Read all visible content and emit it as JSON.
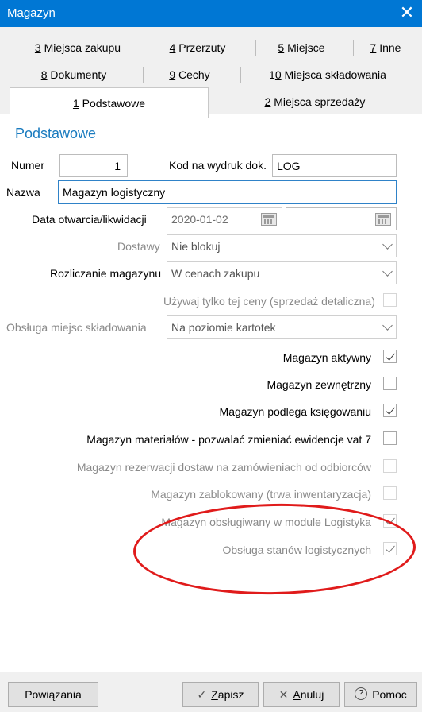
{
  "window": {
    "title": "Magazyn",
    "close_glyph": "✕"
  },
  "tabs": {
    "row1": [
      {
        "num": "3",
        "label": " Miejsca zakupu"
      },
      {
        "num": "4",
        "label": " Przerzuty"
      },
      {
        "num": "5",
        "label": " Miejsce"
      },
      {
        "num": "7",
        "label": " Inne"
      }
    ],
    "row2": [
      {
        "num": "8",
        "label": " Dokumenty"
      },
      {
        "num": "9",
        "label": " Cechy"
      },
      {
        "num_prefix": "1",
        "num": "0",
        "label": " Miejsca składowania"
      }
    ],
    "row3": [
      {
        "num": "1",
        "label": " Podstawowe",
        "active": true
      },
      {
        "num": "2",
        "label": " Miejsca sprzedaży"
      }
    ]
  },
  "section_title": "Podstawowe",
  "fields": {
    "numer": {
      "label": "Numer",
      "value": "1"
    },
    "kod": {
      "label": "Kod na wydruk dok.",
      "value": "LOG"
    },
    "nazwa": {
      "label": "Nazwa",
      "value": "Magazyn logistyczny"
    },
    "data": {
      "label": "Data otwarcia/likwidacji",
      "value": "2020-01-02",
      "value2": ""
    },
    "dostawy": {
      "label": "Dostawy",
      "value": "Nie blokuj"
    },
    "rozliczanie": {
      "label": "Rozliczanie magazynu",
      "value": "W cenach zakupu"
    },
    "uzywaj": {
      "label": "Używaj tylko tej ceny (sprzedaż detaliczna)",
      "checked": false
    },
    "obsluga_miejsc": {
      "label": "Obsługa miejsc składowania",
      "value": "Na poziomie kartotek"
    }
  },
  "checkboxes": [
    {
      "label": "Magazyn aktywny",
      "checked": true,
      "enabled": true
    },
    {
      "label": "Magazyn zewnętrzny",
      "checked": false,
      "enabled": true
    },
    {
      "label": "Magazyn podlega księgowaniu",
      "checked": true,
      "enabled": true
    },
    {
      "label": "Magazyn materiałów - pozwalać zmieniać ewidencje vat 7",
      "checked": false,
      "enabled": true
    },
    {
      "label": "Magazyn rezerwacji dostaw na zamówieniach od odbiorców",
      "checked": false,
      "enabled": false
    },
    {
      "label": "Magazyn zablokowany (trwa inwentaryzacja)",
      "checked": false,
      "enabled": false
    },
    {
      "label": "Magazyn obsługiwany w module Logistyka",
      "checked": true,
      "enabled": false
    },
    {
      "label": "Obsługa stanów logistycznych",
      "checked": true,
      "enabled": false
    }
  ],
  "buttons": {
    "powiazania": "Powiązania",
    "zapisz": {
      "icon": "✓",
      "u": "Z",
      "rest": "apisz"
    },
    "anuluj": {
      "icon": "✕",
      "u": "A",
      "rest": "nuluj"
    },
    "pomoc": {
      "icon": "?",
      "label": "Pomoc"
    }
  },
  "colors": {
    "accent": "#0077d4",
    "section": "#1a7bbf",
    "highlight": "#e01b1b"
  }
}
